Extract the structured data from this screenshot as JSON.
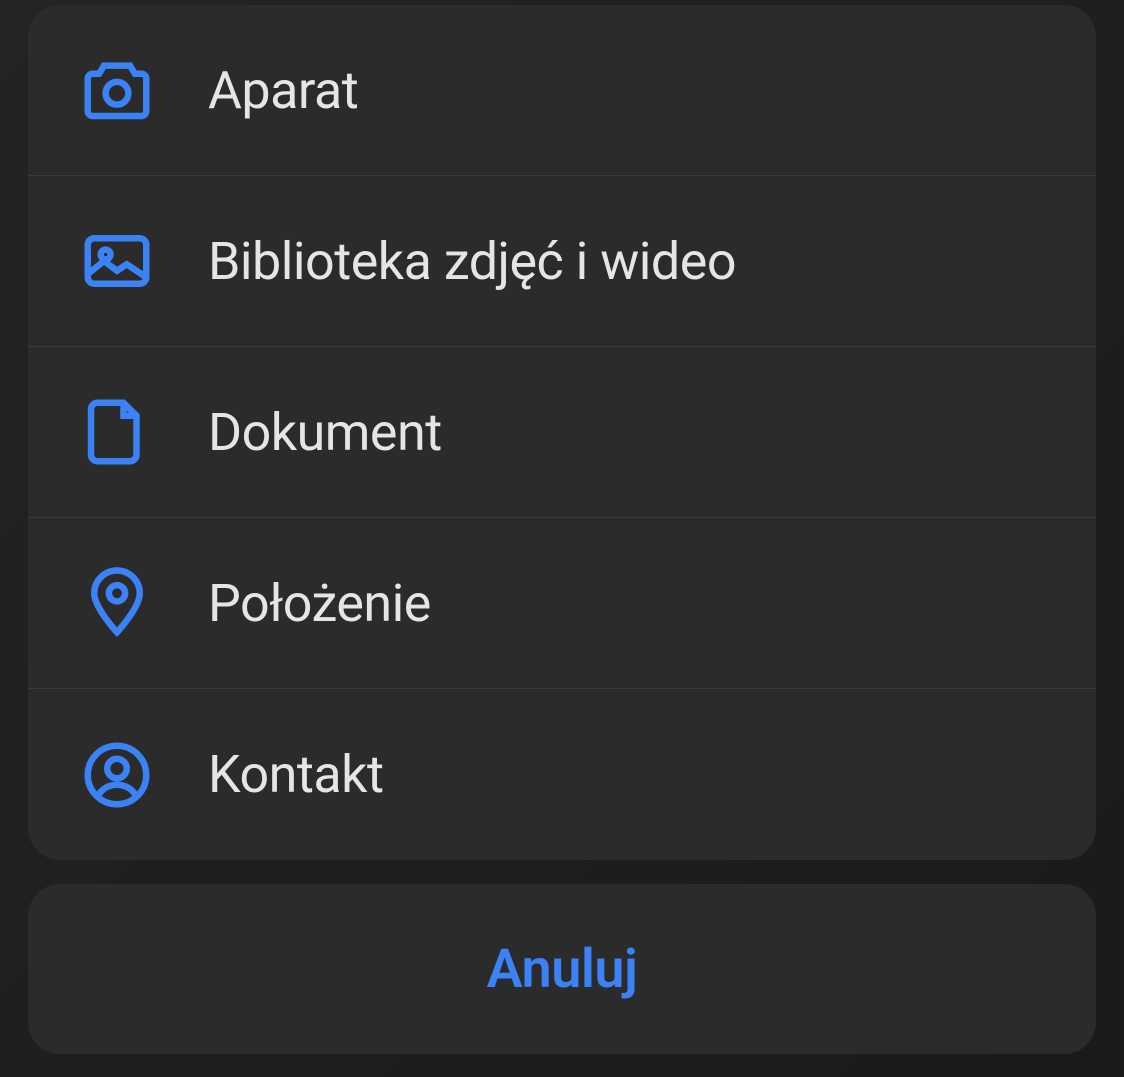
{
  "menu": {
    "items": [
      {
        "icon": "camera",
        "label": "Aparat"
      },
      {
        "icon": "photo-library",
        "label": "Biblioteka zdjęć i wideo"
      },
      {
        "icon": "document",
        "label": "Dokument"
      },
      {
        "icon": "location",
        "label": "Położenie"
      },
      {
        "icon": "contact",
        "label": "Kontakt"
      }
    ]
  },
  "cancel": {
    "label": "Anuluj"
  },
  "colors": {
    "accent": "#3b82f6",
    "text": "#e5e5e5",
    "sheet_bg": "rgba(44, 44, 44, 0.96)"
  }
}
